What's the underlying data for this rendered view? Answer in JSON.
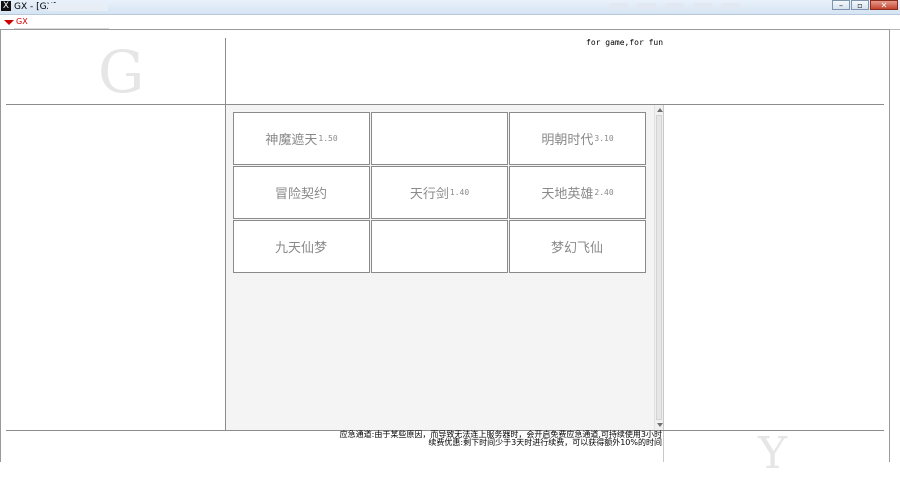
{
  "window": {
    "title": "GX - [GX]",
    "app_icon": "X",
    "buttons": [
      "minimize",
      "maximize",
      "close"
    ]
  },
  "toolbar": {
    "dropdown_label": "GX"
  },
  "header": {
    "tagline": "for game,for fun",
    "logo_left": "G",
    "logo_right": "Y"
  },
  "games": [
    {
      "name": "神魔遮天",
      "version": "1.50"
    },
    {
      "name": "",
      "version": ""
    },
    {
      "name": "明朝时代",
      "version": "3.10"
    },
    {
      "name": "冒险契约",
      "version": ""
    },
    {
      "name": "天行剑",
      "version": "1.40"
    },
    {
      "name": "天地英雄",
      "version": "2.40"
    },
    {
      "name": "九天仙梦",
      "version": ""
    },
    {
      "name": "",
      "version": ""
    },
    {
      "name": "梦幻飞仙",
      "version": ""
    }
  ],
  "footer": {
    "line1": "应急通道:由于某些原因，而导致无法连上服务器时，会开启免费应急通道,可持续使用3小时",
    "line2": "续费优惠:剩下时间少于3天时进行续费，可以获得额外10%的时间"
  },
  "colors": {
    "toolbar_accent": "#d00000",
    "tile_text": "#8a8a8a",
    "panel_bg": "#f4f4f4"
  }
}
